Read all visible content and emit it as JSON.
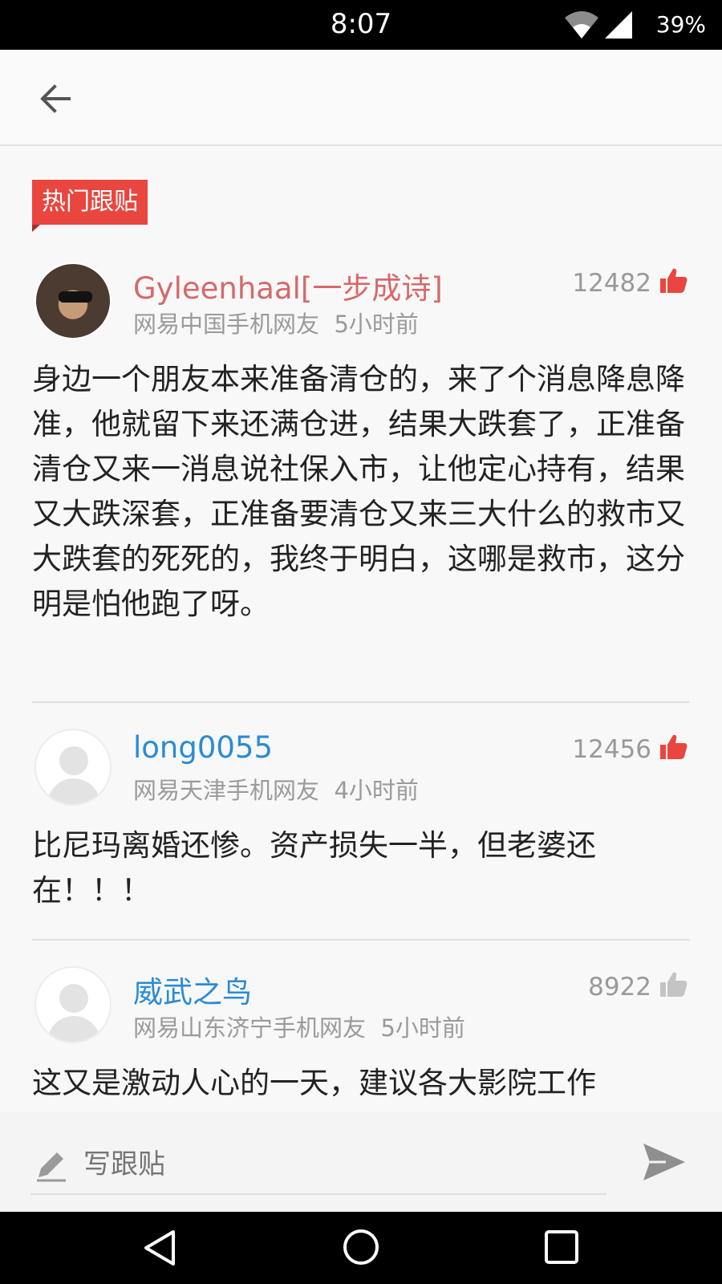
{
  "status_bar": {
    "time": "8:07",
    "battery": "39%"
  },
  "section_label": "热门跟贴",
  "comments": [
    {
      "username": "Gyleenhaal[一步成诗]",
      "location": "网易中国手机网友",
      "time": "5小时前",
      "likes": "12482",
      "liked": true,
      "text": "身边一个朋友本来准备清仓的，来了个消息降息降准，他就留下来还满仓进，结果大跌套了，正准备清仓又来一消息说社保入市，让他定心持有，结果又大跌深套，正准备要清仓又来三大什么的救市又大跌套的死死的，我终于明白，这哪是救市，这分明是怕他跑了呀。"
    },
    {
      "username": "long0055",
      "location": "网易天津手机网友",
      "time": "4小时前",
      "likes": "12456",
      "liked": true,
      "text": "比尼玛离婚还惨。资产损失一半，但老婆还在！！！"
    },
    {
      "username": "威武之鸟",
      "location": "网易山东济宁手机网友",
      "time": "5小时前",
      "likes": "8922",
      "liked": false,
      "text": "这又是激动人心的一天，建议各大影院工作"
    }
  ],
  "reply": {
    "placeholder": "写跟贴"
  },
  "colors": {
    "accent": "#e9463f",
    "username_blue": "#2b8bd4",
    "username_red": "#d76969"
  }
}
